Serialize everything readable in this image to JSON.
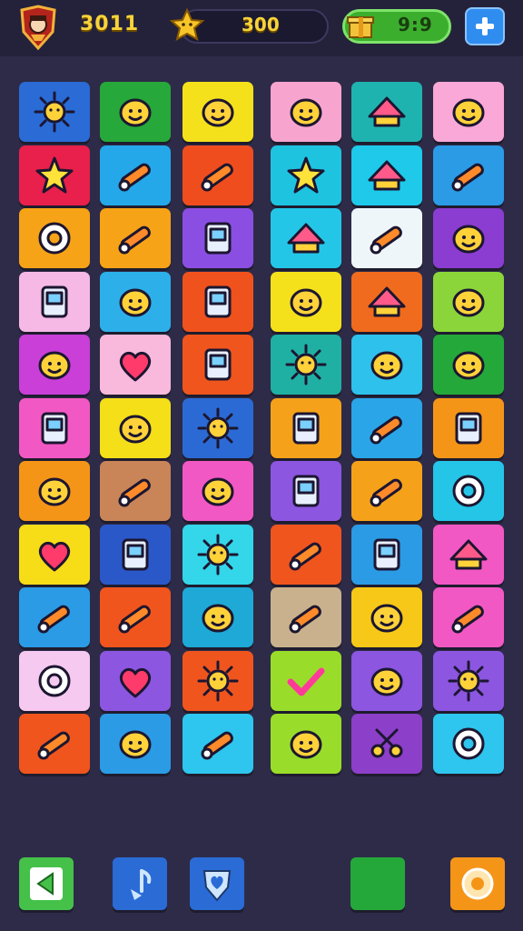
{
  "header": {
    "level": "3011",
    "stars": "300",
    "timer": "9:9",
    "avatar_icon": "crest-avatar-icon",
    "star_icon": "star-icon",
    "timer_icon": "gift-box-icon",
    "add_icon": "plus-icon"
  },
  "grid": {
    "rows": [
      [
        {
          "color": "#2a6bd6",
          "icon": "sun-badge-icon"
        },
        {
          "color": "#26a83a",
          "icon": "balloon-icon"
        },
        {
          "color": "#f4e11b",
          "icon": "lollipop-face-icon"
        },
        {
          "color": "#f7a5cf",
          "icon": "splash-icon"
        },
        {
          "color": "#1fb3b0",
          "icon": "ghost-hat-icon"
        },
        {
          "color": "#f9a8d8",
          "icon": "cloud-bowl-icon"
        }
      ],
      [
        {
          "color": "#e8204b",
          "icon": "sparkles-icon"
        },
        {
          "color": "#24a8ea",
          "icon": "magnifier-icon"
        },
        {
          "color": "#f04d1f",
          "icon": "wrench-icon"
        },
        {
          "color": "#1ec3e0",
          "icon": "starburst-icon"
        },
        {
          "color": "#1ec9ea",
          "icon": "hat-icon"
        },
        {
          "color": "#2b9be6",
          "icon": "brush-icon"
        }
      ],
      [
        {
          "color": "#f7a318",
          "icon": "no-sign-icon"
        },
        {
          "color": "#f7a318",
          "icon": "sausage-icon"
        },
        {
          "color": "#8a4fe2",
          "icon": "jar-icon"
        },
        {
          "color": "#24c6e8",
          "icon": "witch-hat-icon"
        },
        {
          "color": "#eef6fa",
          "icon": "crayon-icon"
        },
        {
          "color": "#8a3dd0",
          "icon": "robot-icon"
        }
      ],
      [
        {
          "color": "#f6b9e6",
          "icon": "card-icon"
        },
        {
          "color": "#2db0ea",
          "icon": "paper-plane-icon"
        },
        {
          "color": "#f0521d",
          "icon": "phone-icon"
        },
        {
          "color": "#f4e11b",
          "icon": "goat-icon"
        },
        {
          "color": "#f06b1d",
          "icon": "house-icon"
        },
        {
          "color": "#8bd53b",
          "icon": "bat-icon"
        }
      ],
      [
        {
          "color": "#c93fd8",
          "icon": "blob-icon"
        },
        {
          "color": "#f9b9dc",
          "icon": "heart-icon"
        },
        {
          "color": "#f0551e",
          "icon": "bandage-icon"
        },
        {
          "color": "#1fb0a3",
          "icon": "sunflower-icon"
        },
        {
          "color": "#2ec1ec",
          "icon": "tulip-icon"
        },
        {
          "color": "#25a83a",
          "icon": "fox-icon"
        }
      ],
      [
        {
          "color": "#f258c4",
          "icon": "lantern-icon"
        },
        {
          "color": "#f4df18",
          "icon": "speech-bubble-icon"
        },
        {
          "color": "#2b6ad4",
          "icon": "virus-icon"
        },
        {
          "color": "#f5a21a",
          "icon": "bottle-icon"
        },
        {
          "color": "#2aa5e8",
          "icon": "pickle-icon"
        },
        {
          "color": "#f59518",
          "icon": "cassette-icon"
        }
      ],
      [
        {
          "color": "#f59518",
          "icon": "smiley-pan-icon"
        },
        {
          "color": "#c98458",
          "icon": "bone-key-icon"
        },
        {
          "color": "#f258c4",
          "icon": "turtle-icon"
        },
        {
          "color": "#8c56e0",
          "icon": "radio-icon"
        },
        {
          "color": "#f5a21a",
          "icon": "paintbrush-icon"
        },
        {
          "color": "#25c5e8",
          "icon": "donut-icon"
        }
      ],
      [
        {
          "color": "#f7dc18",
          "icon": "hearts-cluster-icon"
        },
        {
          "color": "#2a58c9",
          "icon": "book-icon"
        },
        {
          "color": "#34d6ea",
          "icon": "germ-icon"
        },
        {
          "color": "#f0551e",
          "icon": "carrot-icon"
        },
        {
          "color": "#2b9be6",
          "icon": "traffic-light-icon"
        },
        {
          "color": "#f258c4",
          "icon": "cheese-icon"
        }
      ],
      [
        {
          "color": "#2b9be6",
          "icon": "magnifying-glass-icon"
        },
        {
          "color": "#f0551e",
          "icon": "airplane-icon"
        },
        {
          "color": "#1ea9d6",
          "icon": "bean-icon"
        },
        {
          "color": "#c8b18c",
          "icon": "spoon-icon"
        },
        {
          "color": "#f7c818",
          "icon": "octopus-icon"
        },
        {
          "color": "#f258c4",
          "icon": "pill-icon"
        }
      ],
      [
        {
          "color": "#f6c9f0",
          "icon": "planet-icon"
        },
        {
          "color": "#8c56e0",
          "icon": "heart-icon"
        },
        {
          "color": "#f0551e",
          "icon": "sun-face-icon"
        },
        {
          "color": "#99dd2a",
          "icon": "check-icon"
        },
        {
          "color": "#8c56e0",
          "icon": "teapot-icon"
        },
        {
          "color": "#8c56e0",
          "icon": "flower-icon"
        }
      ],
      [
        {
          "color": "#f0551e",
          "icon": "plunger-icon"
        },
        {
          "color": "#2b9be6",
          "icon": "monster-icon"
        },
        {
          "color": "#2ec5ee",
          "icon": "maraca-icon"
        },
        {
          "color": "#99dd2a",
          "icon": "lightbulb-icon"
        },
        {
          "color": "#8c3fc8",
          "icon": "scissors-icon"
        },
        {
          "color": "#2ec5ee",
          "icon": "ring-icon"
        }
      ]
    ]
  },
  "footer": {
    "buttons": [
      {
        "color": "#45c14a",
        "icon": "back-arrow-icon"
      },
      {
        "color": "#2a6bd6",
        "icon": "music-note-icon"
      },
      {
        "color": "#2a6bd6",
        "icon": "shield-heart-icon"
      },
      {
        "color": "#25a83a",
        "icon": "blank-square-icon"
      },
      {
        "color": "#f59518",
        "icon": "coin-icon"
      }
    ]
  }
}
